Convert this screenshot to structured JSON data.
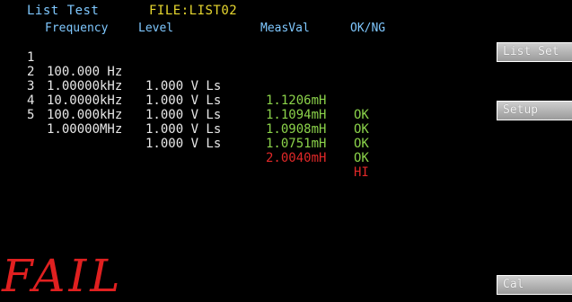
{
  "header": {
    "title": "List Test",
    "file": "FILE:LIST02"
  },
  "columns": {
    "frequency": "Frequency",
    "level": "Level",
    "measval": "MeasVal",
    "okng": "OK/NG"
  },
  "rows": [
    {
      "index": "1",
      "frequency": "100.000 Hz",
      "level": "1.000 V Ls",
      "measval": "1.1206mH",
      "status": "OK",
      "color": "#8bd24a"
    },
    {
      "index": "2",
      "frequency": "1.00000kHz",
      "level": "1.000 V Ls",
      "measval": "1.1094mH",
      "status": "OK",
      "color": "#8bd24a"
    },
    {
      "index": "3",
      "frequency": "10.0000kHz",
      "level": "1.000 V Ls",
      "measval": "1.0908mH",
      "status": "OK",
      "color": "#8bd24a"
    },
    {
      "index": "4",
      "frequency": "100.000kHz",
      "level": "1.000 V Ls",
      "measval": "1.0751mH",
      "status": "OK",
      "color": "#8bd24a"
    },
    {
      "index": "5",
      "frequency": "1.00000MHz",
      "level": "1.000 V Ls",
      "measval": "2.0040mH",
      "status": "HI",
      "color": "#e02828"
    }
  ],
  "result": "FAIL",
  "softkeys": {
    "list_set": "List Set",
    "setup": "Setup",
    "cal": "Cal"
  }
}
